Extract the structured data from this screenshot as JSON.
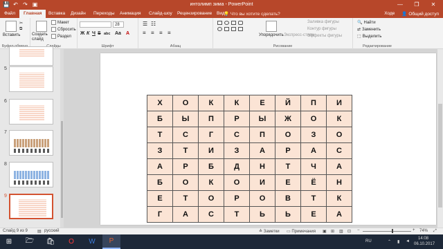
{
  "window": {
    "title": "интолимп зима - PowerPoint",
    "minimize": "—",
    "restore": "❐",
    "close": "✕"
  },
  "qat": {
    "save": "💾",
    "undo": "↶",
    "redo": "↷",
    "present": "▣"
  },
  "tabs": [
    "Файл",
    "Главная",
    "Вставка",
    "Дизайн",
    "Переходы",
    "Анимация",
    "Слайд-шоу",
    "Рецензирование",
    "Вид"
  ],
  "tell_me": "Что вы хотите сделать?",
  "account": {
    "user": "Ходе",
    "share": "Общий доступ"
  },
  "ribbon": {
    "clipboard": {
      "paste": "Вставить",
      "label": "Буфер обмена"
    },
    "slides": {
      "new": "Создать слайд",
      "layout": "Макет",
      "reset": "Сбросить",
      "section": "Раздел",
      "label": "Слайды"
    },
    "font": {
      "name": "",
      "size": "28",
      "label": "Шрифт",
      "bold": "Ж",
      "italic": "К",
      "underline": "Ч",
      "strike": "S",
      "spacing": "abc",
      "aa": "Aa",
      "color": "A"
    },
    "paragraph": {
      "label": "Абзац"
    },
    "drawing": {
      "arrange": "Упорядочить",
      "quick_styles": "Экспресс-стили",
      "fill": "Заливка фигуры",
      "outline": "Контур фигуры",
      "effects": "Эффекты фигуры",
      "label": "Рисование"
    },
    "editing": {
      "find": "Найти",
      "replace": "Заменить",
      "select": "Выделить",
      "label": "Редактирование"
    }
  },
  "slides": [
    {
      "n": "5"
    },
    {
      "n": "6"
    },
    {
      "n": "7"
    },
    {
      "n": "8"
    },
    {
      "n": "9"
    }
  ],
  "puzzle": [
    [
      "Х",
      "О",
      "К",
      "К",
      "Е",
      "Й",
      "П",
      "И"
    ],
    [
      "Б",
      "Ы",
      "П",
      "Р",
      "Ы",
      "Ж",
      "О",
      "К"
    ],
    [
      "Т",
      "С",
      "Г",
      "С",
      "П",
      "О",
      "З",
      "О"
    ],
    [
      "З",
      "Т",
      "И",
      "З",
      "А",
      "Р",
      "А",
      "С"
    ],
    [
      "А",
      "Р",
      "Б",
      "Д",
      "Н",
      "Т",
      "Ч",
      "А"
    ],
    [
      "Б",
      "О",
      "К",
      "О",
      "И",
      "Е",
      "Ё",
      "Н"
    ],
    [
      "Е",
      "Т",
      "О",
      "Р",
      "О",
      "В",
      "Т",
      "К"
    ],
    [
      "Г",
      "А",
      "С",
      "Т",
      "Ь",
      "Ь",
      "Е",
      "А"
    ]
  ],
  "status": {
    "slide": "Слайд 9 из 9",
    "lang": "русский",
    "notes": "Заметки",
    "comments": "Примечания",
    "zoom": "74%"
  },
  "taskbar": {
    "lang": "RU",
    "time": "14:08",
    "date": "06.10.2017"
  },
  "colors": {
    "accent": "#b7472a",
    "cell": "#fbe4d5"
  }
}
